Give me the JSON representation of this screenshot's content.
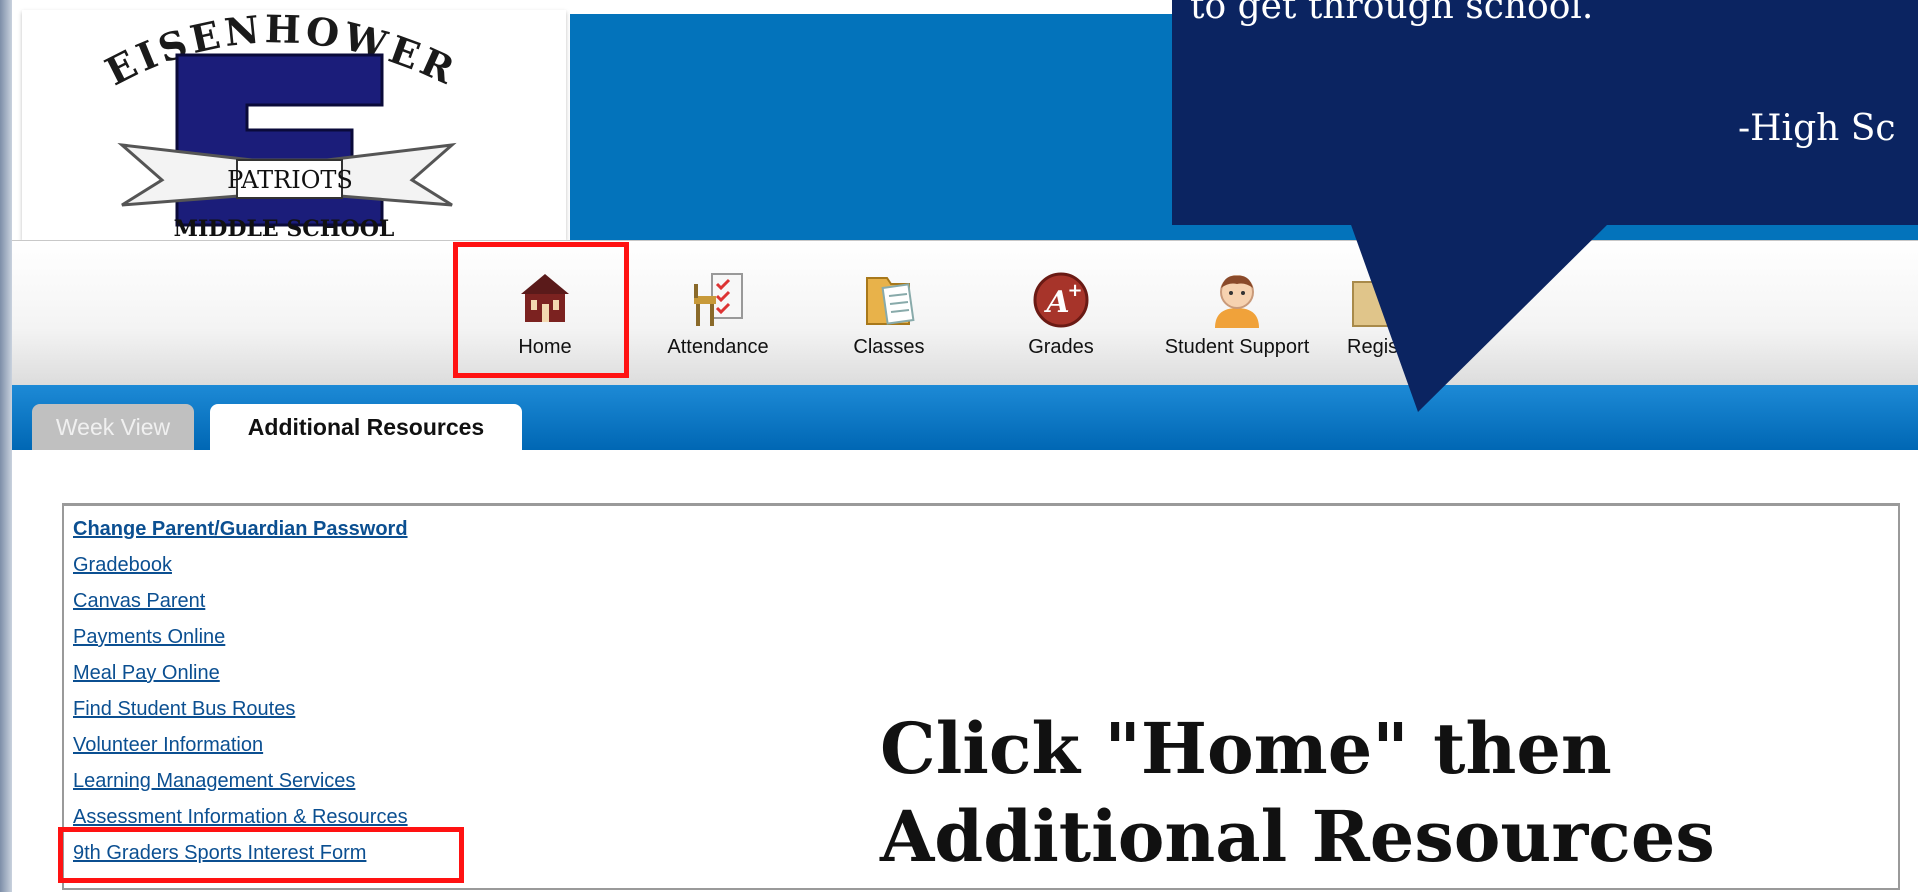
{
  "logo": {
    "school_arc": "EISENHOWER",
    "letter": "E",
    "mascot": "PATRIOTS",
    "school_type": "MIDDLE SCHOOL"
  },
  "nav": {
    "items": [
      {
        "label": "Home",
        "icon": "home-icon"
      },
      {
        "label": "Attendance",
        "icon": "attendance-checklist-icon"
      },
      {
        "label": "Classes",
        "icon": "classes-folder-icon"
      },
      {
        "label": "Grades",
        "icon": "grades-a-plus-icon"
      },
      {
        "label": "Student Support",
        "icon": "student-support-icon"
      },
      {
        "label": "Regis",
        "icon": "registration-icon"
      }
    ]
  },
  "tabs": [
    {
      "label": "Week View",
      "active": false
    },
    {
      "label": "Additional Resources",
      "active": true
    }
  ],
  "resources": {
    "links": [
      "Change Parent/Guardian Password",
      "Gradebook",
      "Canvas Parent",
      "Payments Online",
      "Meal Pay Online",
      "Find Student Bus Routes",
      "Volunteer Information",
      "Learning Management Services",
      "Assessment Information & Resources",
      "9th Graders Sports Interest Form"
    ]
  },
  "instruction": {
    "line1": "Click \"Home\" then",
    "line2": "Additional Resources"
  },
  "callout": {
    "line1": "to get through school.",
    "line2": "-High Sc"
  },
  "colors": {
    "banner_blue": "#0373bb",
    "callout_navy": "#0b2461",
    "highlight_red": "#ff1212",
    "link_blue": "#0b4f91"
  }
}
